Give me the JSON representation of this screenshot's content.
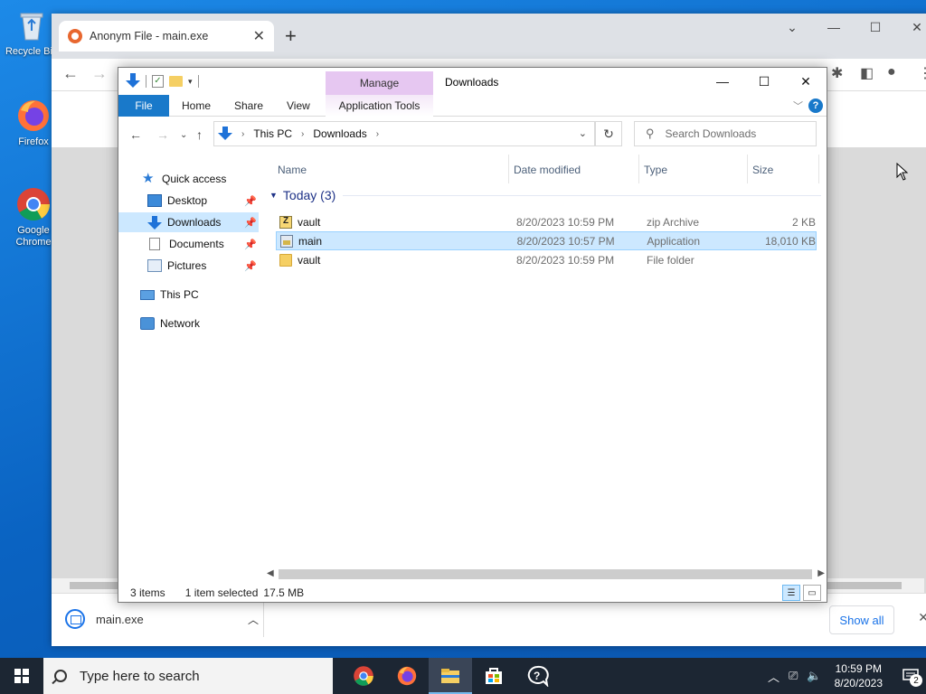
{
  "desktop": {
    "icons": [
      {
        "label": "Recycle Bin",
        "icon": "recycle-bin-icon"
      },
      {
        "label": "Firefox",
        "icon": "firefox-icon"
      },
      {
        "label": "Google Chrome",
        "icon": "chrome-icon"
      }
    ]
  },
  "browser": {
    "tab_title": "Anonym File - main.exe",
    "download": {
      "filename": "main.exe",
      "show_all_label": "Show all"
    }
  },
  "explorer": {
    "ribbon": {
      "manage_label": "Manage",
      "window_title": "Downloads",
      "tabs": [
        "File",
        "Home",
        "Share",
        "View",
        "Application Tools"
      ]
    },
    "address": {
      "segments": [
        "This PC",
        "Downloads"
      ]
    },
    "search_placeholder": "Search Downloads",
    "nav": {
      "quick_access": "Quick access",
      "items": [
        {
          "label": "Desktop",
          "pinned": true
        },
        {
          "label": "Downloads",
          "pinned": true,
          "selected": true
        },
        {
          "label": "Documents",
          "pinned": true
        },
        {
          "label": "Pictures",
          "pinned": true
        }
      ],
      "this_pc": "This PC",
      "network": "Network"
    },
    "columns": {
      "name": "Name",
      "date": "Date modified",
      "type": "Type",
      "size": "Size"
    },
    "group": {
      "label": "Today (3)"
    },
    "files": [
      {
        "name": "vault",
        "date": "8/20/2023 10:59 PM",
        "type": "zip Archive",
        "size": "2 KB",
        "icon": "zip-icon",
        "selected": false
      },
      {
        "name": "main",
        "date": "8/20/2023 10:57 PM",
        "type": "Application",
        "size": "18,010 KB",
        "icon": "application-icon",
        "selected": true
      },
      {
        "name": "vault",
        "date": "8/20/2023 10:59 PM",
        "type": "File folder",
        "size": "",
        "icon": "folder-icon",
        "selected": false
      }
    ],
    "status": {
      "items": "3 items",
      "selected": "1 item selected",
      "size": "17.5 MB"
    }
  },
  "taskbar": {
    "search_placeholder": "Type here to search",
    "apps": [
      "chrome-icon",
      "firefox-icon",
      "file-explorer-icon",
      "store-icon",
      "help-icon"
    ],
    "time": "10:59 PM",
    "date": "8/20/2023",
    "notification_count": "2"
  }
}
